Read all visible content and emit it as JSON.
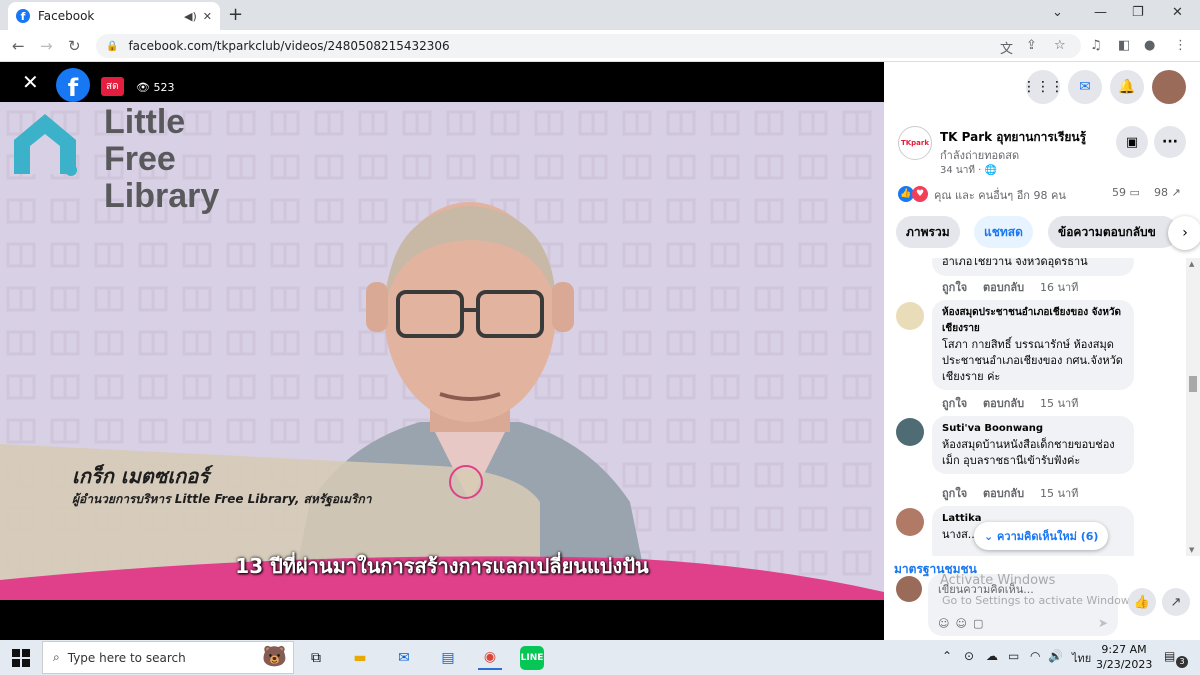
{
  "browser": {
    "tab_title": "Facebook",
    "url": "facebook.com/tkparkclub/videos/2480508215432306",
    "new_tab_symbol": "+"
  },
  "video": {
    "close_symbol": "✕",
    "live_badge": "สด",
    "view_count": "523",
    "logo_lines": [
      "Little",
      "Free",
      "Library"
    ],
    "speaker_name": "เกร็ก เมตซเกอร์",
    "speaker_role": "ผู้อำนวยการบริหาร Little Free Library, สหรัฐอเมริกา",
    "subtitle": "13 ปีที่ผ่านมาในการสร้างการแลกเปลี่ยนแบ่งปัน"
  },
  "sidebar": {
    "page_name": "TK Park อุทยานการเรียนรู้",
    "page_status": "กำลังถ่ายทอดสด",
    "post_time": "34 นาที · ",
    "reactions_text": "คุณ และ คนอื่นๆ อีก 98 คน",
    "comment_count": "59",
    "share_count": "98",
    "tabs": [
      {
        "label": "ภาพรวม"
      },
      {
        "label": "แชทสด"
      },
      {
        "label": "ข้อความตอบกลับข"
      }
    ],
    "comments": [
      {
        "name": "",
        "text": "อำเภอไชยวาน จังหวัดอุดรธานี",
        "like_label": "ถูกใจ",
        "reply_label": "ตอบกลับ",
        "time": "16 นาที"
      },
      {
        "name": "ห้องสมุดประชาชนอำเภอเชียงของ จังหวัดเชียงราย",
        "text": "โสภา กายสิทธิ์ บรรณารักษ์ ห้องสมุดประชาชนอำเภอเชียงของ กศน.จังหวัดเชียงราย ค่ะ",
        "like_label": "ถูกใจ",
        "reply_label": "ตอบกลับ",
        "time": "15 นาที"
      },
      {
        "name": "Suti'va Boonwang",
        "text": "ห้องสมุดบ้านหนังสือเด็กชายขอบช่องเม็ก อุบลราชธานีเข้ารับฟังค่ะ",
        "like_label": "ถูกใจ",
        "reply_label": "ตอบกลับ",
        "time": "15 นาที"
      },
      {
        "name": "Lattika",
        "text": "นางส... ห้องสมุดประชาชนจังหวัด",
        "like_label": "",
        "reply_label": "",
        "time": ""
      }
    ],
    "new_comments_pill": "ความคิดเห็นใหม่ (6)",
    "community_standards": "มาตรฐานชุมชน",
    "comment_placeholder": "เขียนความคิดเห็น...",
    "activate_title": "Activate Windows",
    "activate_sub": "Go to Settings to activate Windows."
  },
  "taskbar": {
    "search_placeholder": "Type here to search",
    "language": "ไทย",
    "time": "9:27 AM",
    "date": "3/23/2023",
    "notification_count": "3"
  },
  "colors": {
    "fb_blue": "#1877f2",
    "live_red": "#e41e3f",
    "video_bg": "#d8d0e4",
    "lower_third_pink": "#e0408a"
  }
}
